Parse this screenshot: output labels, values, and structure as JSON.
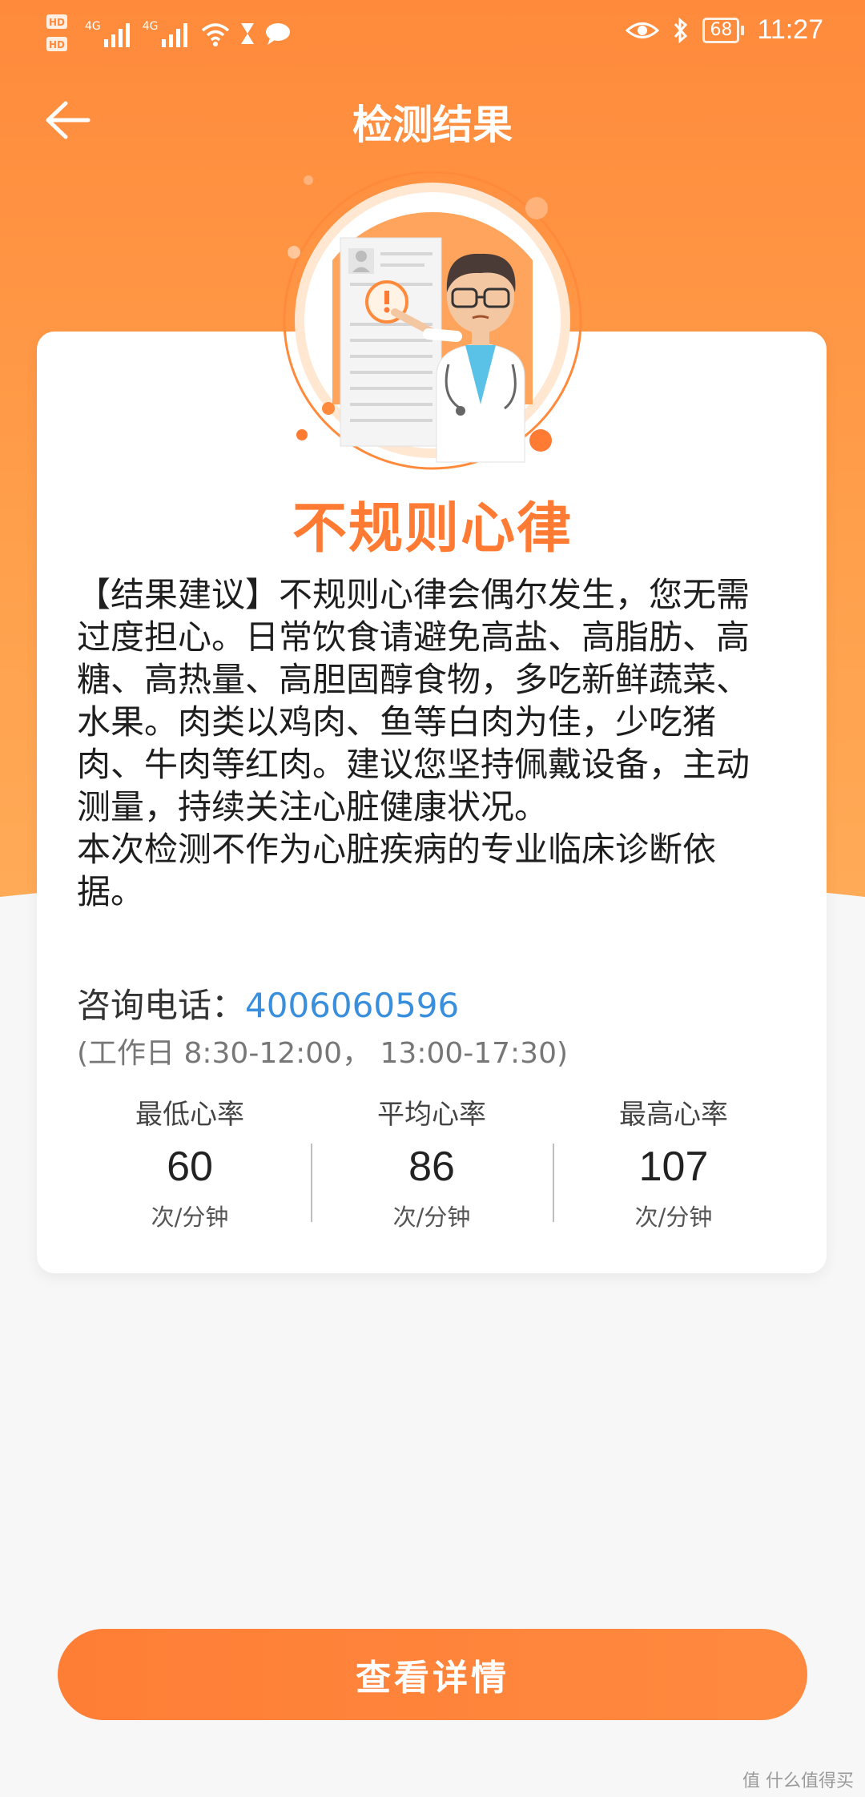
{
  "status_bar": {
    "network_left": "HD",
    "network_1": "4G",
    "network_2": "4G",
    "battery": "68",
    "time": "11:27"
  },
  "header": {
    "title": "检测结果"
  },
  "result": {
    "title": "不规则心律",
    "advice_paragraphs": [
      "【结果建议】不规则心律会偶尔发生，您无需过度担心。日常饮食请避免高盐、高脂肪、高糖、高热量、高胆固醇食物，多吃新鲜蔬菜、水果。肉类以鸡肉、鱼等白肉为佳，少吃猪肉、牛肉等红肉。建议您坚持佩戴设备，主动测量，持续关注心脏健康状况。",
      "本次检测不作为心脏疾病的专业临床诊断依据。"
    ],
    "phone_label": "咨询电话：",
    "phone_number": "4006060596",
    "hours": "(工作日 8:30-12:00， 13:00-17:30)"
  },
  "stats": [
    {
      "label": "最低心率",
      "value": "60",
      "unit": "次/分钟"
    },
    {
      "label": "平均心率",
      "value": "86",
      "unit": "次/分钟"
    },
    {
      "label": "最高心率",
      "value": "107",
      "unit": "次/分钟"
    }
  ],
  "actions": {
    "detail_button": "查看详情"
  },
  "watermark": "值 什么值得买",
  "colors": {
    "accent": "#ff7a33",
    "link": "#3a8fdc"
  }
}
